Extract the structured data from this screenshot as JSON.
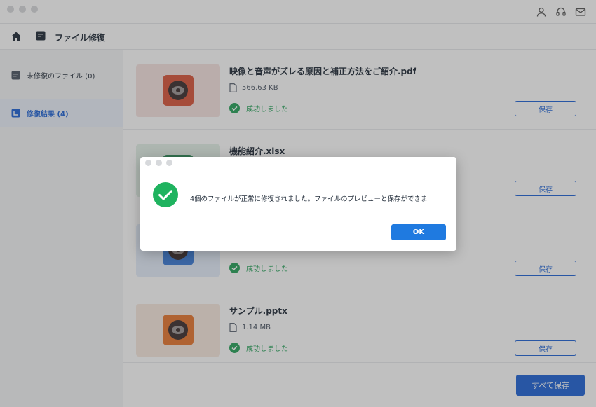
{
  "toolbar": {
    "title": "ファイル修復"
  },
  "sidebar": {
    "items": [
      {
        "label": "未修復のファイル (0)",
        "active": false
      },
      {
        "label": "修復結果 (4)",
        "active": true
      }
    ]
  },
  "files": [
    {
      "name": "映像と音声がズレる原因と補正方法をご紹介.pdf",
      "size": "566.63 KB",
      "status": "成功しました",
      "save_label": "保存",
      "thumb_bg": "#f6e4e1",
      "app_color": "#d9553a",
      "app_icon": "eye-app-icon"
    },
    {
      "name": "機能紹介.xlsx",
      "size": "",
      "status": "",
      "save_label": "保存",
      "thumb_bg": "#e3f1e7",
      "app_color": "#2e8b57",
      "app_icon": "eye-app-icon"
    },
    {
      "name": "",
      "size": "",
      "status": "成功しました",
      "save_label": "保存",
      "thumb_bg": "#e5eefb",
      "app_color": "#3b7dd8",
      "app_icon": "eye-app-icon"
    },
    {
      "name": "サンプル.pptx",
      "size": "1.14 MB",
      "status": "成功しました",
      "save_label": "保存",
      "thumb_bg": "#f8e9df",
      "app_color": "#e8762e",
      "app_icon": "eye-app-icon"
    }
  ],
  "footer": {
    "save_all_label": "すべて保存"
  },
  "dialog": {
    "message": "4個のファイルが正常に修復されました。ファイルのプレビューと保存ができま",
    "ok_label": "OK"
  },
  "colors": {
    "accent": "#1f64d6",
    "success": "#27a35a",
    "ok_button": "#1f7ae0"
  },
  "icons": [
    "user-icon",
    "headset-icon",
    "mail-icon",
    "home-icon",
    "document-icon",
    "file-icon",
    "check-circle-icon"
  ]
}
